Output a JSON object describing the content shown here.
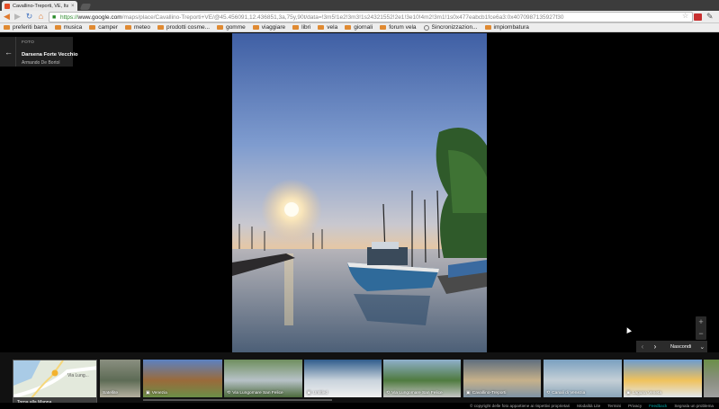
{
  "browser": {
    "tab_title": "Cavallino-Treporti, VE, Ital",
    "tab_close": "×",
    "url_scheme": "https://",
    "url_domain": "www.google.com",
    "url_path": "/maps/place/Cavallino-Treporti+VE/@45.456091,12.436851,3a,75y,90t/data=!3m5!1e2!3m3!1s24321552!2e1!3e10!4m2!3m1!1s0x477eabcb1fce6a3:0x4070987135927f30",
    "icons": {
      "back": "arrow-left",
      "forward": "arrow-right",
      "reload": "reload",
      "home": "home",
      "lock": "lock",
      "star": "star",
      "wrench": "wrench"
    }
  },
  "bookmarks": [
    {
      "label": "preferiti barra",
      "type": "folder"
    },
    {
      "label": "musica",
      "type": "folder"
    },
    {
      "label": "camper",
      "type": "folder"
    },
    {
      "label": "meteo",
      "type": "folder"
    },
    {
      "label": "prodotti cosme...",
      "type": "folder"
    },
    {
      "label": "gomme",
      "type": "folder"
    },
    {
      "label": "viaggiare",
      "type": "folder"
    },
    {
      "label": "libri",
      "type": "folder"
    },
    {
      "label": "vela",
      "type": "folder"
    },
    {
      "label": "giornali",
      "type": "folder"
    },
    {
      "label": "forum vela",
      "type": "folder"
    },
    {
      "label": "Sincronizzazion...",
      "type": "sync"
    },
    {
      "label": "impiombatura",
      "type": "folder"
    }
  ],
  "infocard": {
    "kicker": "FOTO",
    "title": "Darsena Forte Vecchio",
    "author": "Armando De Bortol"
  },
  "zoom": {
    "in": "+",
    "out": "−"
  },
  "strip_controls": {
    "prev": "‹",
    "next": "›",
    "label": "Nascondi",
    "chevron": "⌄"
  },
  "map_thumb": {
    "label": "Torna alla Mappa",
    "road_label": "Via Lung..."
  },
  "thumbnails": [
    {
      "caption": "Satellite",
      "icon": ""
    },
    {
      "caption": "Venezia",
      "icon": "camera"
    },
    {
      "caption": "Via Lungomare San Felice",
      "icon": "360"
    },
    {
      "caption": "Untitled",
      "icon": "camera"
    },
    {
      "caption": "Via Lungomare San Felice",
      "icon": "360"
    },
    {
      "caption": "Cavallino-Treporti",
      "icon": "camera"
    },
    {
      "caption": "Canali di Venezia",
      "icon": "360"
    },
    {
      "caption": "Laguna Veneta",
      "icon": "camera"
    }
  ],
  "footer": {
    "copyright": "© copyright delle foto appartiene ai rispettivi proprietari",
    "lite": "Modalità Lite",
    "terms": "Termini",
    "privacy": "Privacy",
    "feedback_toggle": "Feedback",
    "report": "Segnala un problema"
  }
}
